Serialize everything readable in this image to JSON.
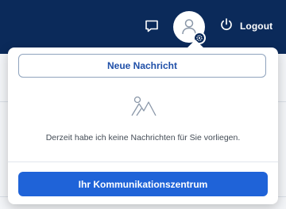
{
  "header": {
    "chat_icon": "chat-bubble-icon",
    "avatar_icon": "user-icon",
    "avatar_badge_icon": "gear-icon",
    "logout_icon": "power-icon",
    "logout_label": "Logout",
    "background_color": "#0b2a5a"
  },
  "popover": {
    "new_message_label": "Neue Nachricht",
    "empty_icon": "mountains-icon",
    "empty_text": "Derzeit habe ich keine Nachrichten für Sie vorliegen.",
    "center_button_label": "Ihr Kommunikationszentrum",
    "accent_color": "#1f63d8"
  }
}
